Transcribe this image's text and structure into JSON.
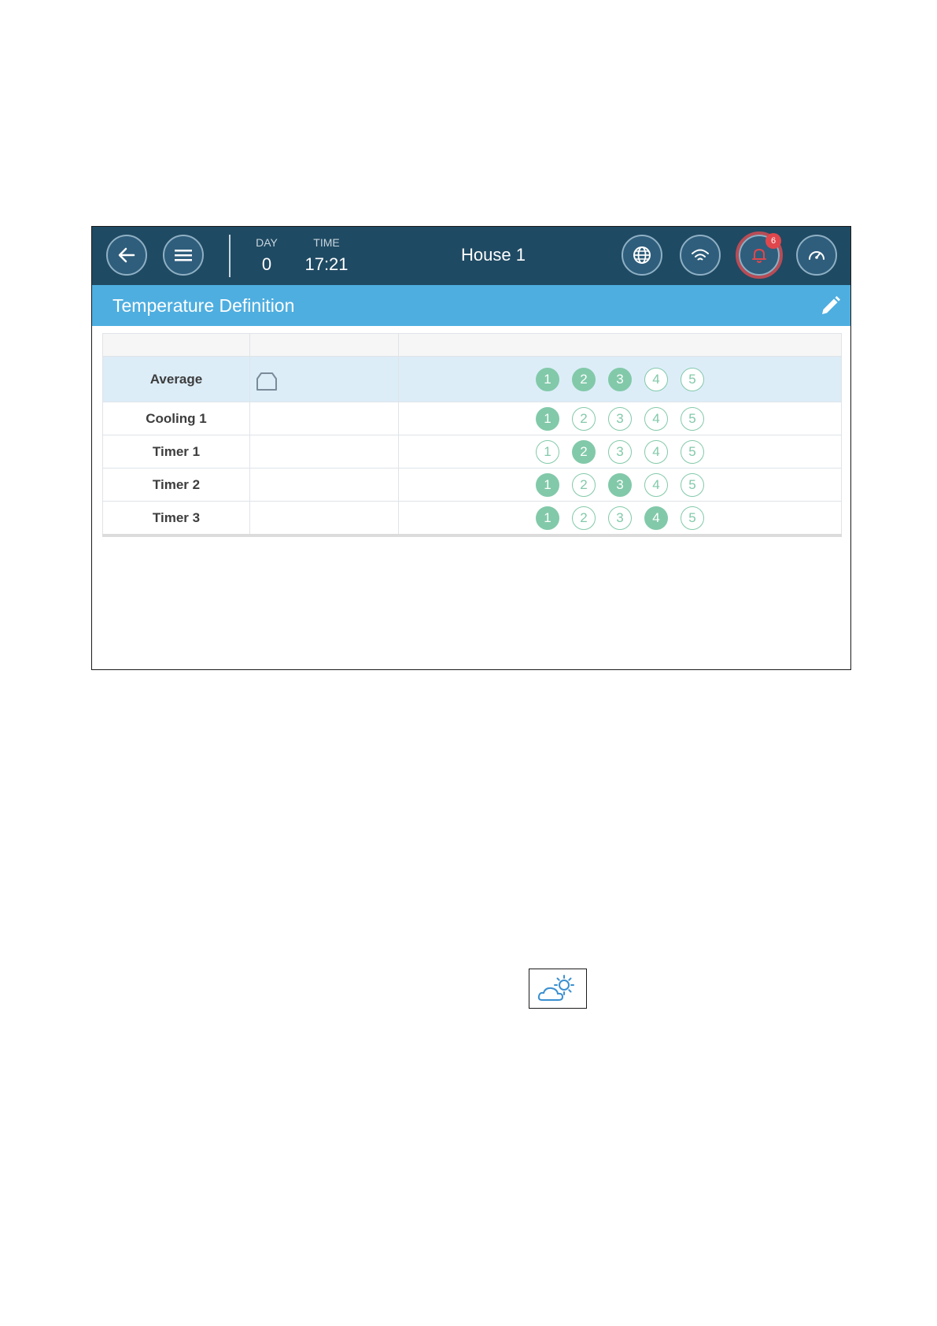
{
  "header": {
    "day_label": "DAY",
    "day_value": "0",
    "time_label": "TIME",
    "time_value": "17:21",
    "house": "House 1",
    "alarm_count": "6"
  },
  "colors": {
    "topbar": "#1f4a63",
    "titlebar": "#4eaee0",
    "active_circle": "#82c9a9",
    "highlight_row": "#dcedf8",
    "alarm": "#e0474c"
  },
  "page": {
    "title": "Temperature Definition"
  },
  "table": {
    "rows": [
      {
        "name": "Average",
        "icon": "house-icon",
        "selected": [
          true,
          true,
          true,
          false,
          false
        ]
      },
      {
        "name": "Cooling 1",
        "icon": "",
        "selected": [
          true,
          false,
          false,
          false,
          false
        ]
      },
      {
        "name": "Timer 1",
        "icon": "",
        "selected": [
          false,
          true,
          false,
          false,
          false
        ]
      },
      {
        "name": "Timer 2",
        "icon": "",
        "selected": [
          true,
          false,
          true,
          false,
          false
        ]
      },
      {
        "name": "Timer 3",
        "icon": "",
        "selected": [
          true,
          false,
          false,
          true,
          false
        ]
      }
    ],
    "sensor_numbers": [
      "1",
      "2",
      "3",
      "4",
      "5"
    ]
  }
}
